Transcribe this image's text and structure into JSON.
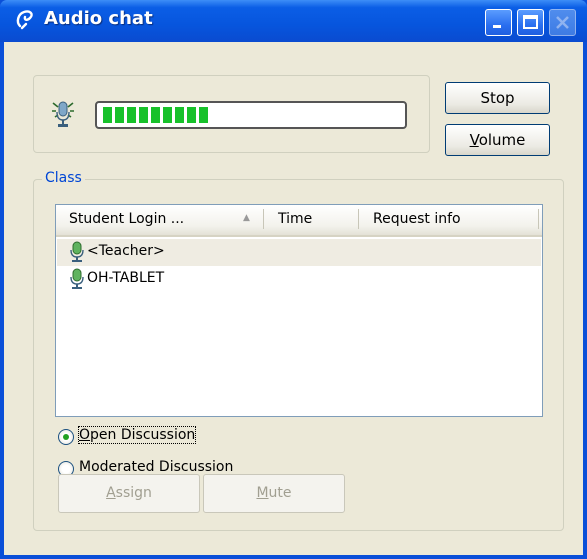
{
  "window": {
    "title": "Audio chat",
    "icon": "audio-chat-icon"
  },
  "level_meter": {
    "icon": "microphone-active-icon",
    "level_segments": 9,
    "level_fraction": 0.35
  },
  "buttons": {
    "stop": "Stop",
    "volume_prefix": "V",
    "volume_rest": "olume"
  },
  "class_group": {
    "label": "Class",
    "columns": [
      "Student Login ...",
      "Time",
      "Request info"
    ],
    "rows": [
      {
        "name": "<Teacher>",
        "icon": "microphone-icon",
        "selected": true
      },
      {
        "name": "OH-TABLET",
        "icon": "microphone-icon",
        "selected": false
      }
    ],
    "modes": {
      "open": {
        "prefix": "O",
        "rest": "pen Discussion",
        "selected": true
      },
      "moderated": {
        "label": "Moderated Discussion",
        "selected": false
      }
    },
    "assign": {
      "prefix": "A",
      "rest": "ssign"
    },
    "mute": {
      "prefix": "M",
      "rest": "ute"
    }
  },
  "colors": {
    "title_bar": "#0a4fd8",
    "meter": "#17c12a",
    "group_label": "#0046d5"
  }
}
